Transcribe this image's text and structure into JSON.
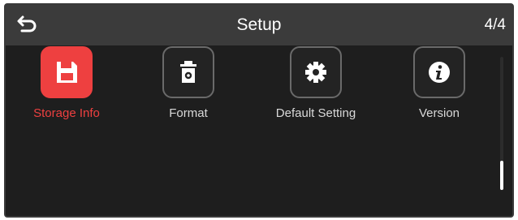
{
  "header": {
    "title": "Setup",
    "page_indicator": "4/4",
    "back_icon": "back-arrow-icon"
  },
  "menu": {
    "items": [
      {
        "label": "Storage Info",
        "icon": "save-icon",
        "selected": true
      },
      {
        "label": "Format",
        "icon": "trash-gear-icon",
        "selected": false
      },
      {
        "label": "Default Setting",
        "icon": "gear-icon",
        "selected": false
      },
      {
        "label": "Version",
        "icon": "info-icon",
        "selected": false
      }
    ]
  },
  "scrollbar": {
    "position": "bottom"
  },
  "colors": {
    "accent": "#ee4040",
    "background": "#1e1e1e",
    "header": "#3b3b3b",
    "text": "#d9d9d9"
  }
}
